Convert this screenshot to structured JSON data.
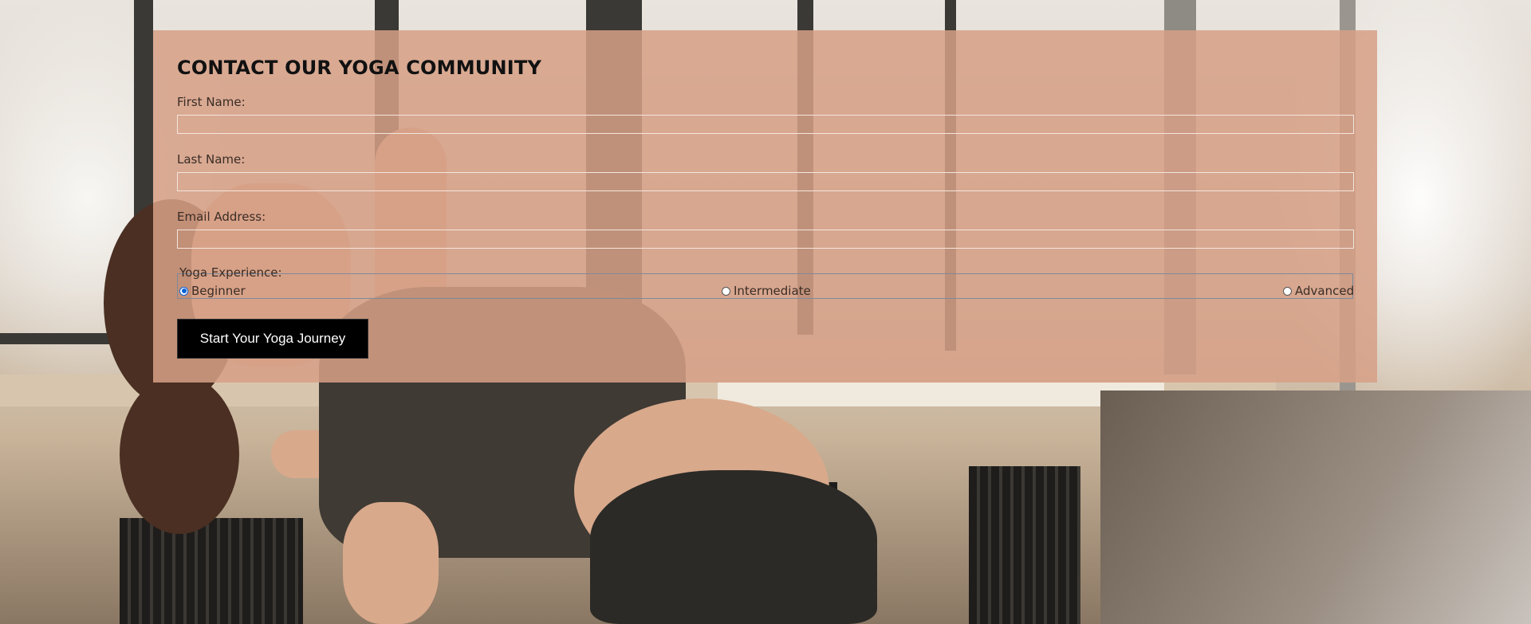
{
  "form": {
    "title": "CONTACT OUR YOGA COMMUNITY",
    "fields": [
      {
        "label": "First Name:",
        "value": "",
        "placeholder": ""
      },
      {
        "label": "Last Name:",
        "value": "",
        "placeholder": ""
      },
      {
        "label": "Email Address:",
        "value": "",
        "placeholder": ""
      }
    ],
    "experience": {
      "legend": "Yoga Experience:",
      "options": [
        "Beginner",
        "Intermediate",
        "Advanced"
      ],
      "selected": "Beginner"
    },
    "submit_label": "Start Your Yoga Journey"
  },
  "colors": {
    "card_overlay": "#d6a086",
    "button_bg": "#000000",
    "radio_accent": "#0a62d6"
  }
}
